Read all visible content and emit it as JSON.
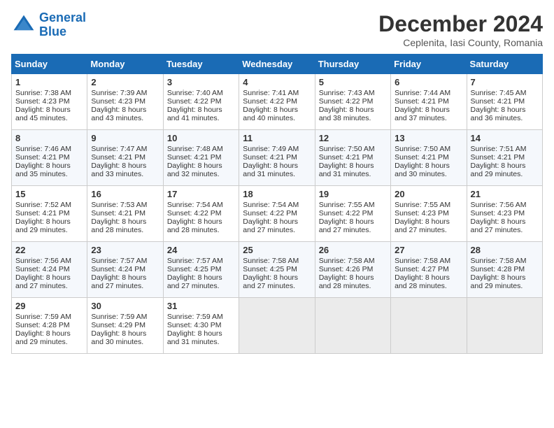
{
  "header": {
    "logo_line1": "General",
    "logo_line2": "Blue",
    "month": "December 2024",
    "location": "Ceplenita, Iasi County, Romania"
  },
  "weekdays": [
    "Sunday",
    "Monday",
    "Tuesday",
    "Wednesday",
    "Thursday",
    "Friday",
    "Saturday"
  ],
  "weeks": [
    [
      {
        "day": "1",
        "lines": [
          "Sunrise: 7:38 AM",
          "Sunset: 4:23 PM",
          "Daylight: 8 hours",
          "and 45 minutes."
        ]
      },
      {
        "day": "2",
        "lines": [
          "Sunrise: 7:39 AM",
          "Sunset: 4:23 PM",
          "Daylight: 8 hours",
          "and 43 minutes."
        ]
      },
      {
        "day": "3",
        "lines": [
          "Sunrise: 7:40 AM",
          "Sunset: 4:22 PM",
          "Daylight: 8 hours",
          "and 41 minutes."
        ]
      },
      {
        "day": "4",
        "lines": [
          "Sunrise: 7:41 AM",
          "Sunset: 4:22 PM",
          "Daylight: 8 hours",
          "and 40 minutes."
        ]
      },
      {
        "day": "5",
        "lines": [
          "Sunrise: 7:43 AM",
          "Sunset: 4:22 PM",
          "Daylight: 8 hours",
          "and 38 minutes."
        ]
      },
      {
        "day": "6",
        "lines": [
          "Sunrise: 7:44 AM",
          "Sunset: 4:21 PM",
          "Daylight: 8 hours",
          "and 37 minutes."
        ]
      },
      {
        "day": "7",
        "lines": [
          "Sunrise: 7:45 AM",
          "Sunset: 4:21 PM",
          "Daylight: 8 hours",
          "and 36 minutes."
        ]
      }
    ],
    [
      {
        "day": "8",
        "lines": [
          "Sunrise: 7:46 AM",
          "Sunset: 4:21 PM",
          "Daylight: 8 hours",
          "and 35 minutes."
        ]
      },
      {
        "day": "9",
        "lines": [
          "Sunrise: 7:47 AM",
          "Sunset: 4:21 PM",
          "Daylight: 8 hours",
          "and 33 minutes."
        ]
      },
      {
        "day": "10",
        "lines": [
          "Sunrise: 7:48 AM",
          "Sunset: 4:21 PM",
          "Daylight: 8 hours",
          "and 32 minutes."
        ]
      },
      {
        "day": "11",
        "lines": [
          "Sunrise: 7:49 AM",
          "Sunset: 4:21 PM",
          "Daylight: 8 hours",
          "and 31 minutes."
        ]
      },
      {
        "day": "12",
        "lines": [
          "Sunrise: 7:50 AM",
          "Sunset: 4:21 PM",
          "Daylight: 8 hours",
          "and 31 minutes."
        ]
      },
      {
        "day": "13",
        "lines": [
          "Sunrise: 7:50 AM",
          "Sunset: 4:21 PM",
          "Daylight: 8 hours",
          "and 30 minutes."
        ]
      },
      {
        "day": "14",
        "lines": [
          "Sunrise: 7:51 AM",
          "Sunset: 4:21 PM",
          "Daylight: 8 hours",
          "and 29 minutes."
        ]
      }
    ],
    [
      {
        "day": "15",
        "lines": [
          "Sunrise: 7:52 AM",
          "Sunset: 4:21 PM",
          "Daylight: 8 hours",
          "and 29 minutes."
        ]
      },
      {
        "day": "16",
        "lines": [
          "Sunrise: 7:53 AM",
          "Sunset: 4:21 PM",
          "Daylight: 8 hours",
          "and 28 minutes."
        ]
      },
      {
        "day": "17",
        "lines": [
          "Sunrise: 7:54 AM",
          "Sunset: 4:22 PM",
          "Daylight: 8 hours",
          "and 28 minutes."
        ]
      },
      {
        "day": "18",
        "lines": [
          "Sunrise: 7:54 AM",
          "Sunset: 4:22 PM",
          "Daylight: 8 hours",
          "and 27 minutes."
        ]
      },
      {
        "day": "19",
        "lines": [
          "Sunrise: 7:55 AM",
          "Sunset: 4:22 PM",
          "Daylight: 8 hours",
          "and 27 minutes."
        ]
      },
      {
        "day": "20",
        "lines": [
          "Sunrise: 7:55 AM",
          "Sunset: 4:23 PM",
          "Daylight: 8 hours",
          "and 27 minutes."
        ]
      },
      {
        "day": "21",
        "lines": [
          "Sunrise: 7:56 AM",
          "Sunset: 4:23 PM",
          "Daylight: 8 hours",
          "and 27 minutes."
        ]
      }
    ],
    [
      {
        "day": "22",
        "lines": [
          "Sunrise: 7:56 AM",
          "Sunset: 4:24 PM",
          "Daylight: 8 hours",
          "and 27 minutes."
        ]
      },
      {
        "day": "23",
        "lines": [
          "Sunrise: 7:57 AM",
          "Sunset: 4:24 PM",
          "Daylight: 8 hours",
          "and 27 minutes."
        ]
      },
      {
        "day": "24",
        "lines": [
          "Sunrise: 7:57 AM",
          "Sunset: 4:25 PM",
          "Daylight: 8 hours",
          "and 27 minutes."
        ]
      },
      {
        "day": "25",
        "lines": [
          "Sunrise: 7:58 AM",
          "Sunset: 4:25 PM",
          "Daylight: 8 hours",
          "and 27 minutes."
        ]
      },
      {
        "day": "26",
        "lines": [
          "Sunrise: 7:58 AM",
          "Sunset: 4:26 PM",
          "Daylight: 8 hours",
          "and 28 minutes."
        ]
      },
      {
        "day": "27",
        "lines": [
          "Sunrise: 7:58 AM",
          "Sunset: 4:27 PM",
          "Daylight: 8 hours",
          "and 28 minutes."
        ]
      },
      {
        "day": "28",
        "lines": [
          "Sunrise: 7:58 AM",
          "Sunset: 4:28 PM",
          "Daylight: 8 hours",
          "and 29 minutes."
        ]
      }
    ],
    [
      {
        "day": "29",
        "lines": [
          "Sunrise: 7:59 AM",
          "Sunset: 4:28 PM",
          "Daylight: 8 hours",
          "and 29 minutes."
        ]
      },
      {
        "day": "30",
        "lines": [
          "Sunrise: 7:59 AM",
          "Sunset: 4:29 PM",
          "Daylight: 8 hours",
          "and 30 minutes."
        ]
      },
      {
        "day": "31",
        "lines": [
          "Sunrise: 7:59 AM",
          "Sunset: 4:30 PM",
          "Daylight: 8 hours",
          "and 31 minutes."
        ]
      },
      {
        "day": "",
        "lines": []
      },
      {
        "day": "",
        "lines": []
      },
      {
        "day": "",
        "lines": []
      },
      {
        "day": "",
        "lines": []
      }
    ]
  ]
}
